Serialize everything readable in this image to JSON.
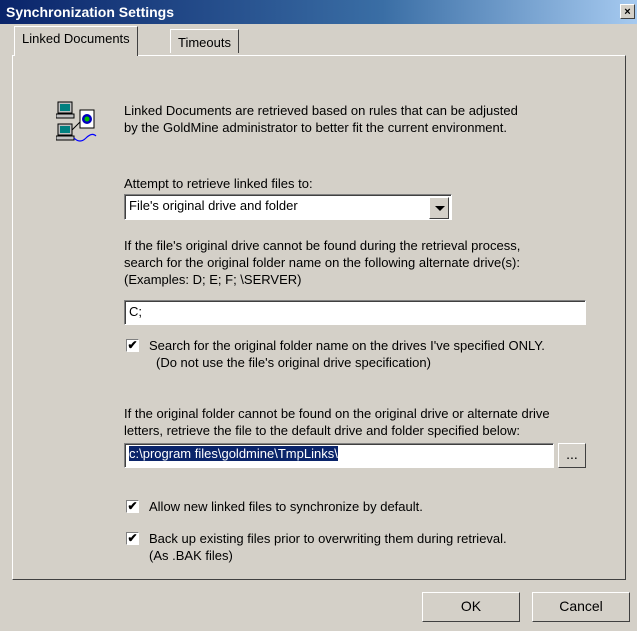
{
  "window": {
    "title": "Synchronization Settings",
    "close_label": "×"
  },
  "tabs": [
    {
      "label": "Linked Documents",
      "active": true
    },
    {
      "label": "Timeouts",
      "active": false
    }
  ],
  "intro": {
    "line1": "Linked Documents are retrieved based on rules that can be adjusted",
    "line2": "by the GoldMine administrator to better fit the current environment."
  },
  "retrieve": {
    "label": "Attempt to retrieve linked files to:",
    "selected": "File's original drive and folder"
  },
  "alternate": {
    "line1": "If the file's original drive cannot be found during the retrieval process,",
    "line2": "search for the original folder name on the following alternate drive(s):",
    "line3": "(Examples:  D; E; F; \\SERVER)",
    "value": "C;"
  },
  "only_checkbox": {
    "checked": true,
    "mark": "✔",
    "line1": "Search for the original folder name on the drives I've specified ONLY.",
    "line2": "(Do not use the file's original drive specification)"
  },
  "default_folder": {
    "line1": "If the original folder cannot be found on the original drive or alternate drive",
    "line2": "letters, retrieve the file to the default drive and folder specified below:",
    "value": "c:\\program files\\goldmine\\TmpLinks\\",
    "browse_label": "..."
  },
  "allow_checkbox": {
    "checked": true,
    "mark": "✔",
    "label": "Allow new linked files to synchronize by default."
  },
  "backup_checkbox": {
    "checked": true,
    "mark": "✔",
    "line1": "Back up existing files prior to overwriting them during retrieval.",
    "line2": "(As .BAK files)"
  },
  "buttons": {
    "ok": "OK",
    "cancel": "Cancel"
  },
  "icons": {
    "linked_docs": "linked-computers-icon"
  }
}
